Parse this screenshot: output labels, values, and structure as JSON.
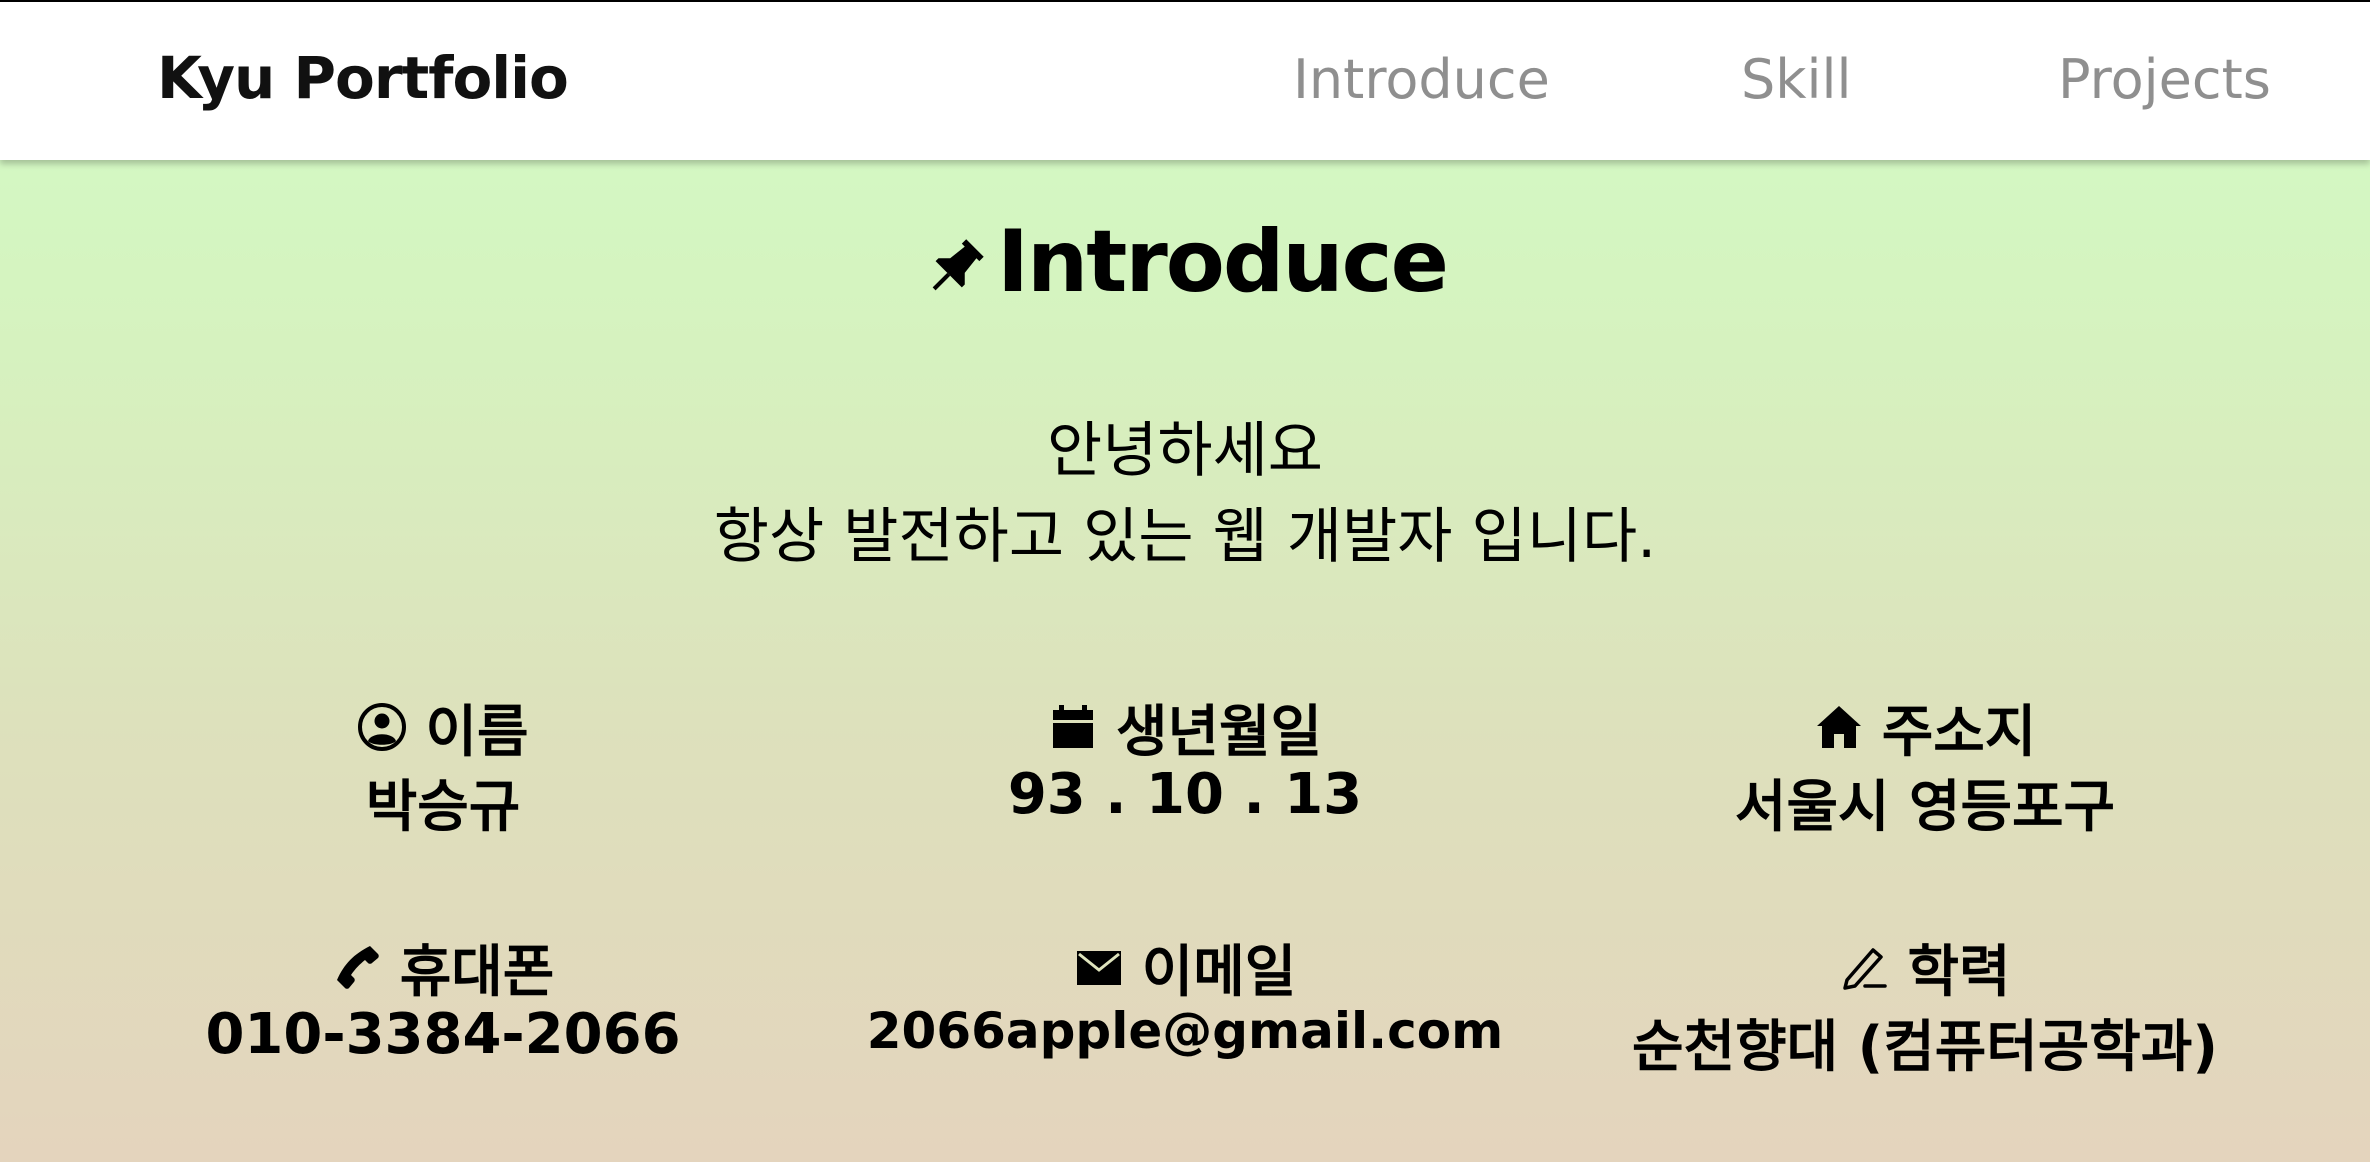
{
  "navbar": {
    "brand": "Kyu Portfolio",
    "links": [
      "Introduce",
      "Skill",
      "Projects"
    ]
  },
  "introduce": {
    "title": "Introduce",
    "title_icon": "pushpin-icon",
    "greeting_line1": "안녕하세요",
    "greeting_line2": "항상 발전하고 있는 웹 개발자 입니다.",
    "info": [
      {
        "icon": "user-circle-icon",
        "label": "이름",
        "value": "박승규"
      },
      {
        "icon": "calendar-icon",
        "label": "생년월일",
        "value": "93 . 10 . 13"
      },
      {
        "icon": "home-icon",
        "label": "주소지",
        "value": "서울시 영등포구"
      },
      {
        "icon": "phone-icon",
        "label": "휴대폰",
        "value": "010-3384-2066"
      },
      {
        "icon": "envelope-icon",
        "label": "이메일",
        "value": "2066apple@gmail.com"
      },
      {
        "icon": "pencil-icon",
        "label": "학력",
        "value": "순천향대 (컴퓨터공학과)"
      }
    ]
  },
  "colors": {
    "nav_background": "#ffffff",
    "nav_link": "#8f8f8f",
    "gradient_top": "#d1fcc5",
    "gradient_bottom": "#e4d4bd",
    "text": "#000000"
  }
}
